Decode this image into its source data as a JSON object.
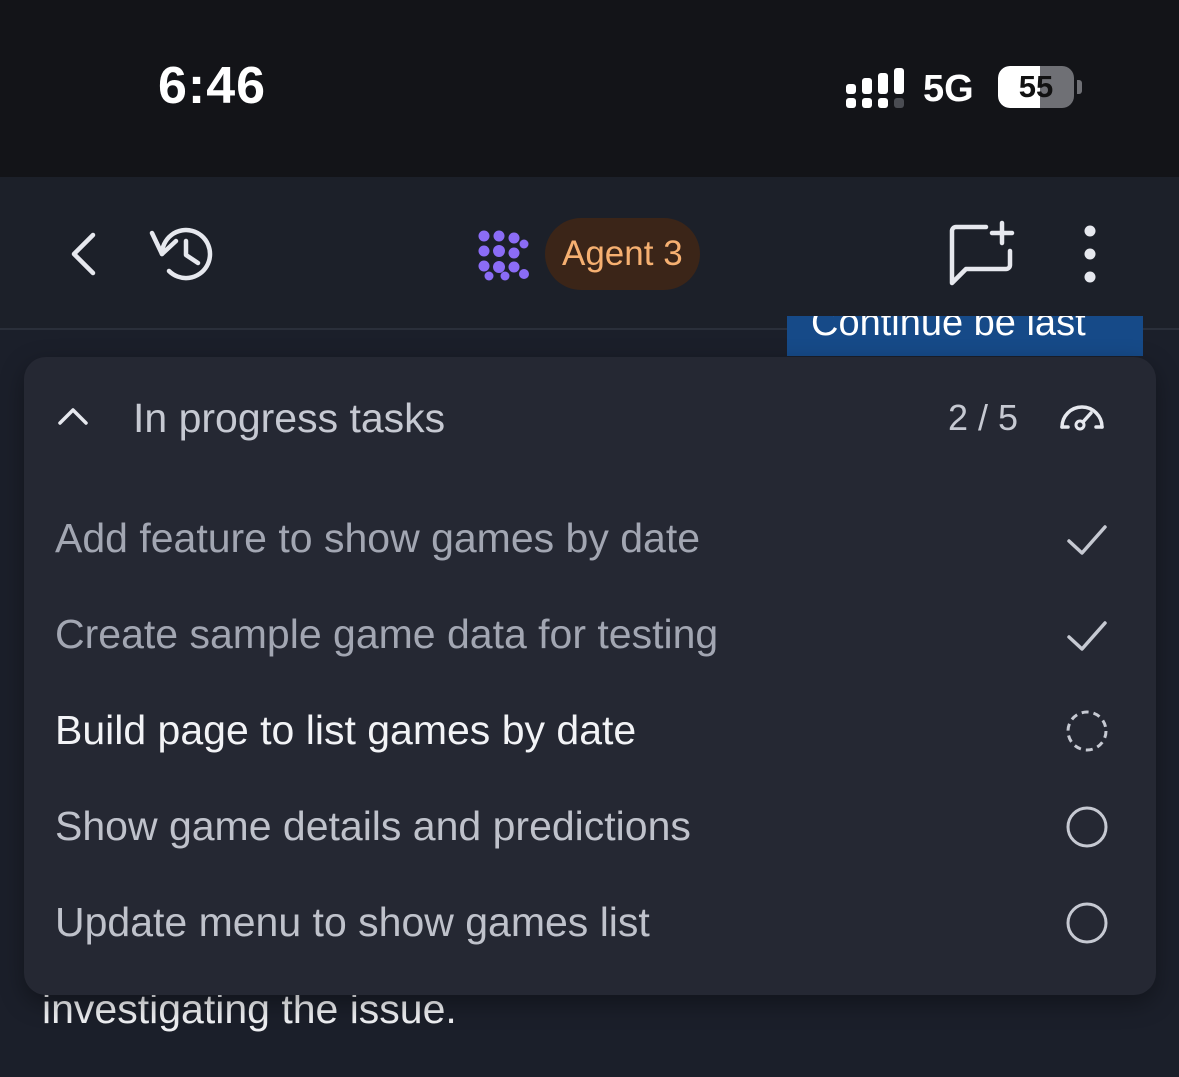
{
  "status_bar": {
    "time": "6:46",
    "network": "5G",
    "battery_percent": 55,
    "battery_label": "55"
  },
  "header": {
    "agent_badge": "Agent 3",
    "icons": [
      "back-icon",
      "history-icon",
      "agent-logo-icon",
      "new-chat-icon",
      "more-vertical-icon"
    ],
    "colors": {
      "agent_badge_bg": "#3b2518",
      "agent_badge_text": "#f6b071",
      "logo": "#8b6cf6"
    }
  },
  "background": {
    "banner_text": "Continue be last",
    "message_text": "investigating the issue."
  },
  "task_panel": {
    "title": "In progress tasks",
    "counter": "2 / 5",
    "tasks": [
      {
        "label": "Add feature to show games by date",
        "status": "completed"
      },
      {
        "label": "Create sample game data for testing",
        "status": "completed"
      },
      {
        "label": "Build page to list games by date",
        "status": "in-progress"
      },
      {
        "label": "Show game details and predictions",
        "status": "pending"
      },
      {
        "label": "Update menu to show games list",
        "status": "pending"
      }
    ]
  }
}
